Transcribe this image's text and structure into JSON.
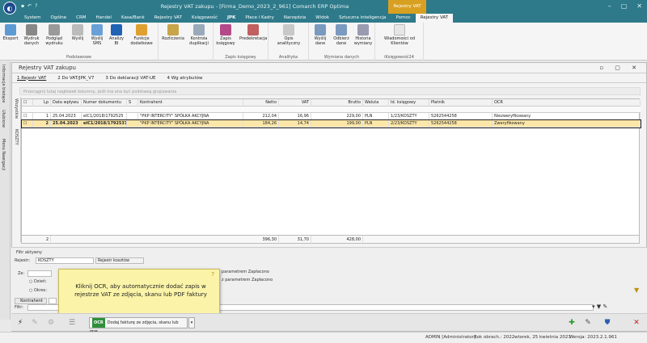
{
  "app": {
    "title": "Rejestry VAT zakupu - [Firma_Demo_2023_2_961] Comarch ERP Optima",
    "context_label": "Rejestry VAT"
  },
  "tabs": [
    {
      "label": "System"
    },
    {
      "label": "Ogólne"
    },
    {
      "label": "CRM"
    },
    {
      "label": "Handel"
    },
    {
      "label": "Kasa/Bank"
    },
    {
      "label": "Rejestry VAT"
    },
    {
      "label": "Księgowość"
    },
    {
      "label": "JPK"
    },
    {
      "label": "Płace i Kadry"
    },
    {
      "label": "Narzędzia"
    },
    {
      "label": "Widok"
    },
    {
      "label": "Sztuczna inteligencja"
    },
    {
      "label": "Pomoc"
    },
    {
      "label": "Rejestry VAT"
    }
  ],
  "ribbon": {
    "buttons": [
      {
        "label": "Eksport"
      },
      {
        "label": "Wydruk danych"
      },
      {
        "label": "Podgląd wydruku"
      },
      {
        "label": "Wyślij"
      },
      {
        "label": "Wyślij SMS"
      },
      {
        "label": "Analizy BI"
      },
      {
        "label": "Funkcje dodatkowe"
      },
      {
        "label": "Rozliczenia"
      },
      {
        "label": "Kontrola duplikacji"
      },
      {
        "label": "Zapis księgowy"
      },
      {
        "label": "Predekretacja"
      },
      {
        "label": "Opis analityczny"
      },
      {
        "label": "Wyślij dane"
      },
      {
        "label": "Odbierz dane"
      },
      {
        "label": "Historia wymiany"
      },
      {
        "label": "Wiadomości od Klientów"
      }
    ],
    "groups": [
      "Podstawowe",
      "Zapis księgowy",
      "Analityka",
      "Wymiana danych",
      "iKsięgowość24"
    ]
  },
  "left_tabs": [
    "Informacje bieżące",
    "Ulubione",
    "Menu Nawigacji"
  ],
  "window": {
    "title": "Rejestry VAT zakupu",
    "controls": "▫ ▢ ✕"
  },
  "subtabs": [
    {
      "label": "1 Rejestr VAT"
    },
    {
      "label": "2 Do VAT/JPK_V7"
    },
    {
      "label": "3 Do deklaracji VAT-UE"
    },
    {
      "label": "4 Wg atrybutów"
    }
  ],
  "grouping_hint": "Przeciągnij tutaj nagłówek kolumny, jeśli ma ona być podstawą grupowania",
  "inner_tabs": [
    "Wszystkie",
    "KOSZTY"
  ],
  "grid": {
    "columns": [
      "Lp",
      "Data wpływu",
      "Numer dokumentu",
      "S",
      "Kontrahent",
      "Netto",
      "VAT",
      "Brutto",
      "Waluta",
      "Id. księgowy",
      "Płatnik",
      "OCR"
    ],
    "rows": [
      {
        "lp": "1",
        "data": "25.04.2023",
        "numer": "eIC1/2018/1792525",
        "s": "",
        "kontrahent": "\"PKP INTERCITY\" SPÓŁKA AKCYJNA",
        "netto": "212,04",
        "vat": "16,96",
        "brutto": "229,00",
        "waluta": "PLN",
        "id": "1/23/KOSZTY",
        "platnik": "5262544258",
        "ocr": "Niezweryfikowany"
      },
      {
        "lp": "2",
        "data": "25.04.2023",
        "numer": "eIC1/2018/1792537",
        "s": "",
        "kontrahent": "\"PKP INTERCITY\" SPÓŁKA AKCYJNA",
        "netto": "184,26",
        "vat": "14,74",
        "brutto": "199,00",
        "waluta": "PLN",
        "id": "2/23/KOSZTY",
        "platnik": "5262544258",
        "ocr": "Zweryfikowany"
      }
    ],
    "summary": {
      "count": "2",
      "netto": "396,30",
      "vat": "31,70",
      "brutto": "428,00"
    }
  },
  "filters": {
    "section": "Filtr aktywny",
    "rejestr_label": "Rejestr:",
    "rejestr_value": "KOSZTY",
    "rejestr_desc": "Rejestr kosztów",
    "ze_label": "Ze:",
    "dzien_label": "Dzień:",
    "okres_label": "Okres:",
    "kontrahent_btn": "Kontrahent",
    "zaplacono1": "parametrem Zapłacono",
    "zaplacono2": "z parametrem Zapłacono",
    "filtr_label": "Filtr:"
  },
  "tooltip": {
    "text": "Kliknij OCR, aby automatycznie dodać zapis w rejestrze VAT ze zdjęcia, skanu lub PDF faktury",
    "q": "?"
  },
  "ocr_button": {
    "badge": "OCR",
    "label": "Dodaj fakturę ze zdjęcia, skanu lub PDF"
  },
  "status": {
    "user": "ADMIN [Administrator]",
    "year": "Rok obrach.: 2022",
    "date": "wtorek, 25 kwietnia 2023",
    "version": "Wersja: 2023.2.1.961"
  },
  "colors": {
    "titlebar": "#2e7a8a",
    "context": "#d8a020",
    "selected_row": "#fce7a9",
    "tooltip": "#fbf4a8"
  }
}
